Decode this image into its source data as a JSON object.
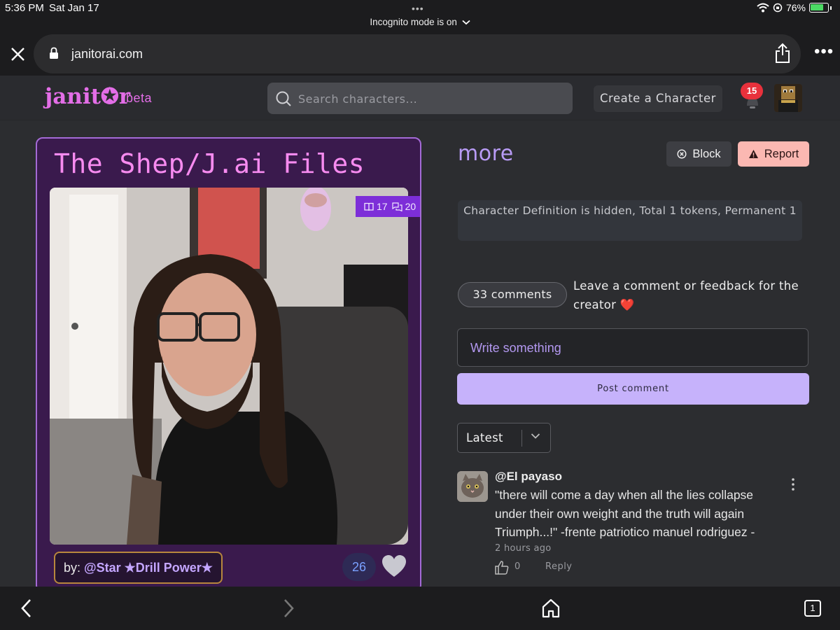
{
  "status_bar": {
    "time": "5:36 PM",
    "date": "Sat Jan 17",
    "incognito": "Incognito mode is on",
    "battery": "76%",
    "battery_level": 0.76
  },
  "browser": {
    "url": "janitorai.com"
  },
  "header": {
    "logo": "janit✪r",
    "logo_suffix": "beta",
    "search_placeholder": "Search characters...",
    "create_label": "Create a Character",
    "notification_count": "15"
  },
  "card": {
    "title": "The Shep/J.ai Files",
    "stats": {
      "tokens": "17",
      "chats": "20"
    },
    "creator_prefix": "by: ",
    "creator_name": "@Star ★Drill Power★",
    "like_count": "26"
  },
  "panel": {
    "heading": "more",
    "block_label": "Block",
    "report_label": "Report",
    "definition_text": "Character Definition is hidden, Total 1 tokens, Permanent 1",
    "comments_count_label": "33 comments",
    "leave_feedback": "Leave a comment or feedback for the creator ❤️",
    "write_placeholder": "Write something",
    "post_label": "Post comment",
    "sort_selected": "Latest"
  },
  "comments": [
    {
      "author": "@El payaso",
      "body": "\"there will come a day when all the lies collapse under their own weight and the truth will again Triumph...!\" -frente patriotico manuel rodriguez -",
      "time": "2 hours ago",
      "likes": "0",
      "reply_label": "Reply"
    }
  ],
  "bottom_bar": {
    "tab_count": "1"
  },
  "colors": {
    "accent": "#c6b2fb",
    "logo": "#e36ee7",
    "card_bg": "#3a1a4d",
    "report": "#fbb8b2",
    "badge": "#e8313c"
  }
}
